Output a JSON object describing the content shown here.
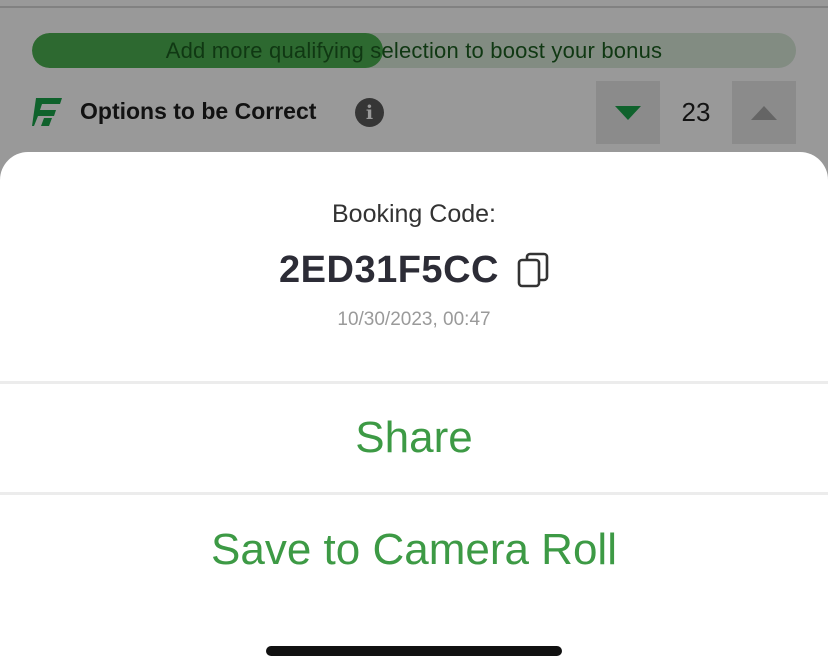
{
  "background": {
    "boost_banner": {
      "text": "Add more qualifying selection to boost your bonus",
      "progress_fraction": 0.46
    },
    "options": {
      "label": "Options to be Correct",
      "info_icon": "info-icon",
      "stepper_value": "23",
      "decrement_icon": "triangle-down-icon",
      "increment_icon": "triangle-up-icon"
    },
    "logo_icon": "brand-logo-icon"
  },
  "sheet": {
    "booking_label": "Booking Code:",
    "booking_code": "2ED31F5CC",
    "copy_icon": "copy-icon",
    "timestamp": "10/30/2023, 00:47",
    "share_label": "Share",
    "save_label": "Save to Camera Roll"
  },
  "colors": {
    "accent_green": "#3d9a45",
    "brand_green": "#1aa34a",
    "overlay": "rgba(0,0,0,0.40)"
  }
}
